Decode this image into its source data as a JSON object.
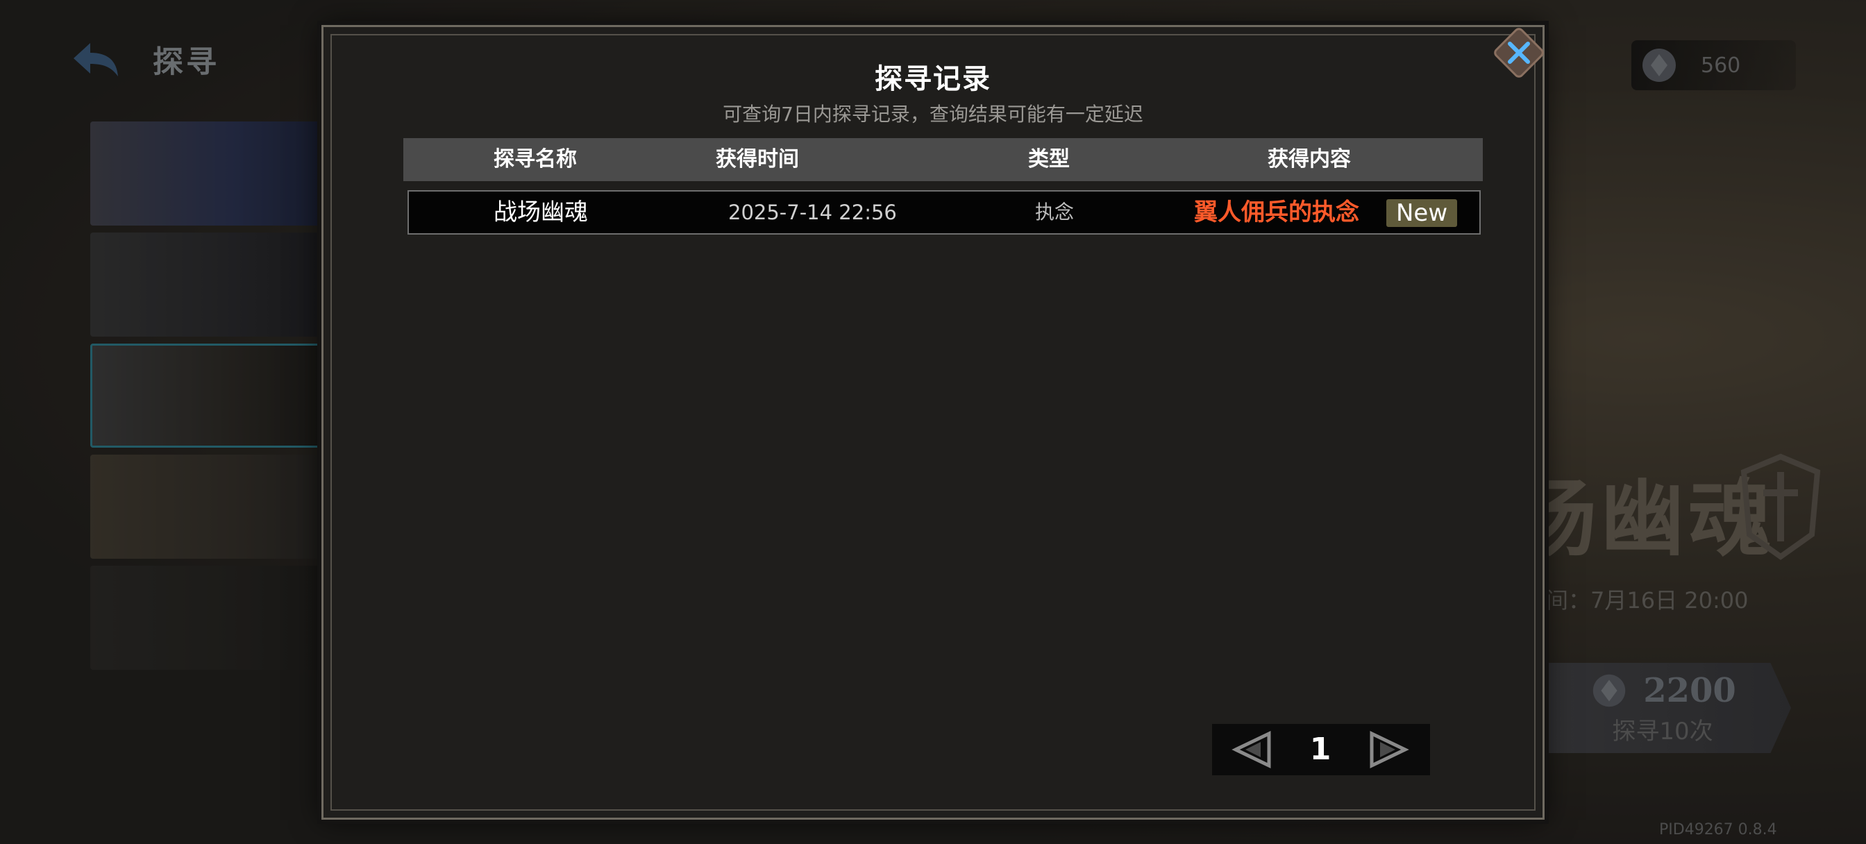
{
  "background": {
    "header_title": "探寻",
    "currency_value": "560",
    "event_title": "场幽魂",
    "event_time": "时间：7月16日 20:00",
    "draw_cost": "2200",
    "draw_label": "探寻10次",
    "pid": "PID49267  0.8.4"
  },
  "modal": {
    "title": "探寻记录",
    "subtitle": "可查询7日内探寻记录，查询结果可能有一定延迟",
    "columns": [
      "探寻名称",
      "获得时间",
      "类型",
      "获得内容"
    ],
    "rows": [
      {
        "name": "战场幽魂",
        "time": "2025-7-14 22:56",
        "type": "执念",
        "content": "翼人佣兵的执念",
        "badge": "New"
      }
    ],
    "page": "1"
  },
  "colors": {
    "content_text": "#ff5a2a",
    "close_icon": "#57b7ff",
    "selected_border": "#3fa5b8"
  }
}
